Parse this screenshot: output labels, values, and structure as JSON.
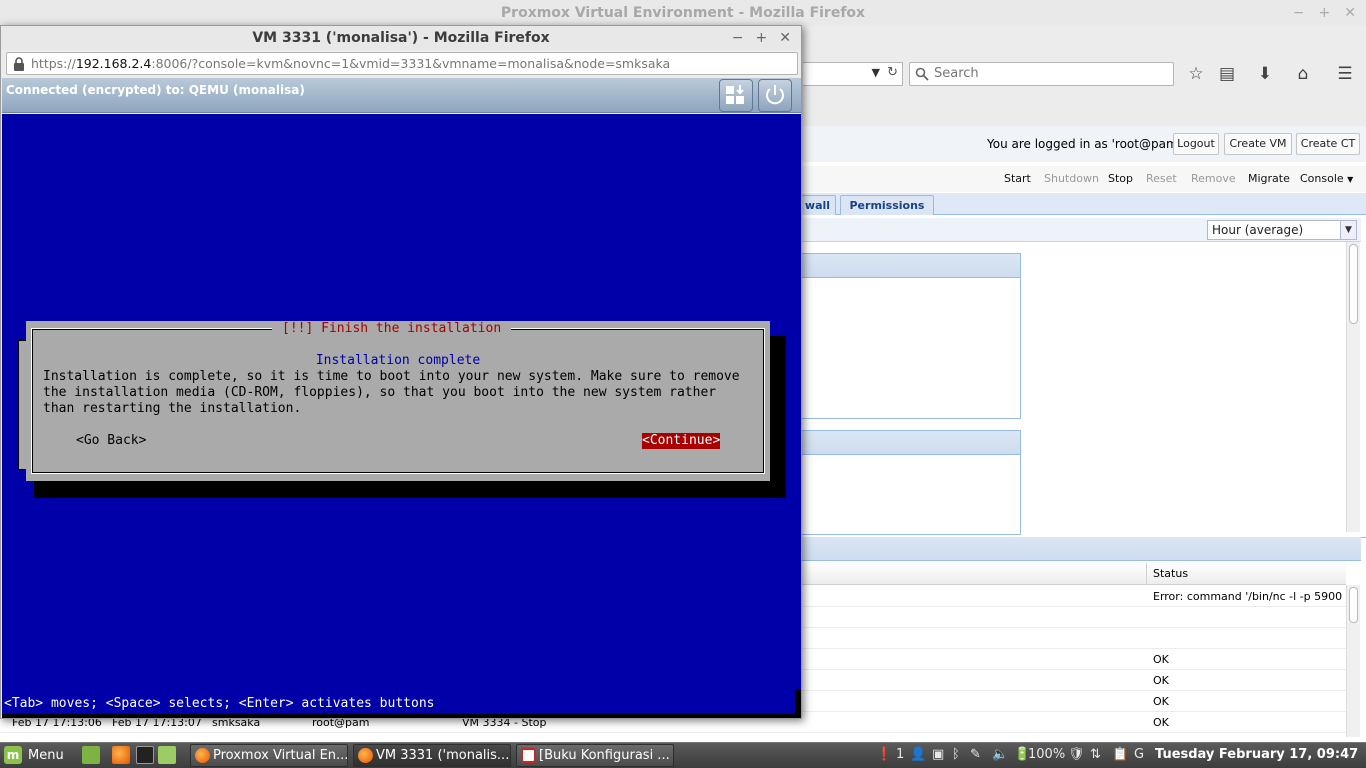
{
  "background_window": {
    "title": "Proxmox Virtual Environment - Mozilla Firefox",
    "search_placeholder": "Search",
    "login_text": "You are logged in as 'root@pam'",
    "buttons": {
      "logout": "Logout",
      "create_vm": "Create VM",
      "create_ct": "Create CT"
    },
    "vm_toolbar": {
      "start": "Start",
      "shutdown": "Shutdown",
      "stop": "Stop",
      "reset": "Reset",
      "remove": "Remove",
      "migrate": "Migrate",
      "console": "Console"
    },
    "tabs": {
      "firewall_partial": "wall",
      "permissions": "Permissions"
    },
    "timeframe": "Hour (average)",
    "log": {
      "status_header": "Status",
      "rows": [
        {
          "status": "Error: command '/bin/nc -l -p 5900 -..."
        },
        {
          "status": ""
        },
        {
          "status": ""
        },
        {
          "status": "OK"
        },
        {
          "status": "OK"
        },
        {
          "status": "OK"
        },
        {
          "start": "Feb 17 17:13:06",
          "end": "Feb 17 17:13:07",
          "node": "smksaka",
          "user": "root@pam",
          "description": "VM 3334 - Stop",
          "status": "OK"
        }
      ]
    }
  },
  "vm_window": {
    "title": "VM 3331 ('monalisa') - Mozilla Firefox",
    "url_prefix": "https://",
    "url_host": "192.168.2.4",
    "url_rest": ":8006/?console=kvm&novnc=1&vmid=3331&vmname=monalisa&node=smksaka",
    "novnc_status": "Connected (encrypted) to: QEMU (monalisa)",
    "installer": {
      "dialog_title": "[!!] Finish the installation",
      "heading": "Installation complete",
      "body": "Installation is complete, so it is time to boot into your new system. Make sure to remove\nthe installation media (CD-ROM, floppies), so that you boot into the new system rather\nthan restarting the installation.",
      "go_back": "<Go Back>",
      "continue": "<Continue>",
      "help_line": "<Tab> moves; <Space> selects; <Enter> activates buttons"
    }
  },
  "taskbar": {
    "menu": "Menu",
    "tasks": [
      {
        "label": "Proxmox Virtual En..."
      },
      {
        "label": "VM 3331 ('monalis..."
      },
      {
        "label": "[Buku Konfigurasi ..."
      }
    ],
    "tray_count": "1",
    "battery": "100%",
    "clock": "Tuesday February 17, 09:47"
  },
  "colors": {
    "console_blue": "#0000a8",
    "dialog_grey": "#aaaaaa",
    "accent_red": "#a80000",
    "pve_tab_text": "#15428b"
  }
}
